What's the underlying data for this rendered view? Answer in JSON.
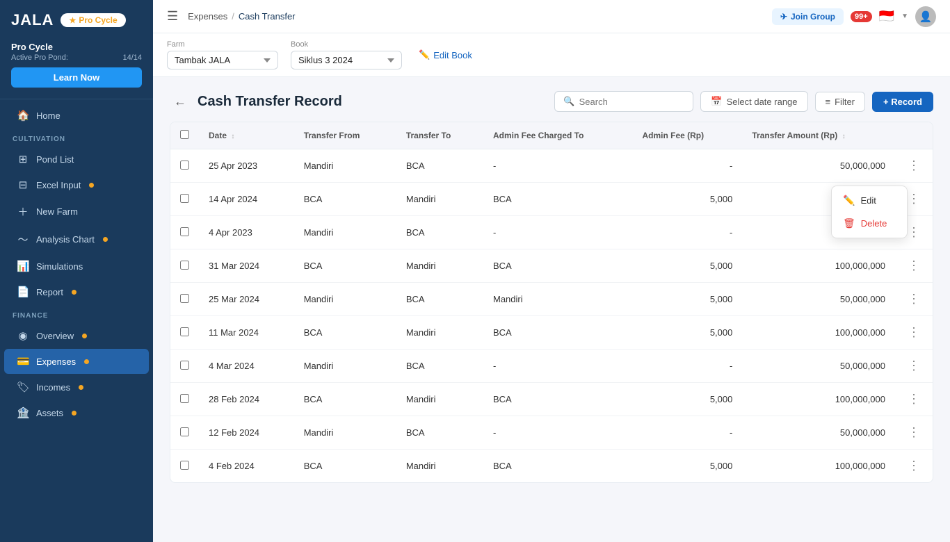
{
  "app": {
    "logo": "JALA",
    "pro_cycle_label": "Pro Cycle",
    "active_pond_label": "Active Pro Pond:",
    "active_pond_value": "14/14"
  },
  "sidebar": {
    "learn_now_label": "Learn Now",
    "nav_items": [
      {
        "id": "home",
        "label": "Home",
        "icon": "🏠",
        "active": false,
        "section": null
      },
      {
        "id": "pond-list",
        "label": "Pond List",
        "icon": "⊞",
        "active": false,
        "section": "CULTIVATION"
      },
      {
        "id": "excel-input",
        "label": "Excel Input",
        "icon": "⊟",
        "active": false,
        "section": null,
        "badge": true
      },
      {
        "id": "new-farm",
        "label": "New Farm",
        "icon": "+",
        "active": false,
        "section": null
      },
      {
        "id": "analysis-chart",
        "label": "Analysis Chart",
        "icon": "~",
        "active": false,
        "section": null,
        "badge": true
      },
      {
        "id": "simulations",
        "label": "Simulations",
        "icon": "📊",
        "active": false,
        "section": null
      },
      {
        "id": "report",
        "label": "Report",
        "icon": "📄",
        "active": false,
        "section": null,
        "badge": true
      },
      {
        "id": "overview",
        "label": "Overview",
        "icon": "◉",
        "active": false,
        "section": "FINANCE",
        "badge": true
      },
      {
        "id": "expenses",
        "label": "Expenses",
        "icon": "💳",
        "active": true,
        "section": null,
        "badge": true
      },
      {
        "id": "incomes",
        "label": "Incomes",
        "icon": "🏷",
        "active": false,
        "section": null,
        "badge": true
      },
      {
        "id": "assets",
        "label": "Assets",
        "icon": "🏦",
        "active": false,
        "section": null,
        "badge": true
      }
    ],
    "sections": [
      "CULTIVATION",
      "FINANCE"
    ]
  },
  "topbar": {
    "breadcrumb_parent": "Expenses",
    "breadcrumb_sep": "/",
    "breadcrumb_current": "Cash Transfer",
    "join_group_label": "Join Group",
    "notif_count": "99+",
    "hamburger_icon": "☰"
  },
  "selectors": {
    "farm_label": "Farm",
    "farm_value": "Tambak JALA",
    "book_label": "Book",
    "book_value": "Siklus 3 2024",
    "edit_book_label": "Edit Book"
  },
  "page": {
    "back_icon": "←",
    "title": "Cash Transfer Record",
    "search_placeholder": "Search",
    "date_range_label": "Select date range",
    "filter_label": "Filter",
    "record_label": "+ Record"
  },
  "table": {
    "columns": [
      {
        "id": "checkbox",
        "label": ""
      },
      {
        "id": "date",
        "label": "Date",
        "sortable": true
      },
      {
        "id": "transfer_from",
        "label": "Transfer From"
      },
      {
        "id": "transfer_to",
        "label": "Transfer To"
      },
      {
        "id": "admin_fee_charged_to",
        "label": "Admin Fee Charged To"
      },
      {
        "id": "admin_fee",
        "label": "Admin Fee (Rp)"
      },
      {
        "id": "transfer_amount",
        "label": "Transfer Amount (Rp)",
        "sortable": true
      },
      {
        "id": "actions",
        "label": ""
      }
    ],
    "rows": [
      {
        "date": "25 Apr 2023",
        "transfer_from": "Mandiri",
        "transfer_to": "BCA",
        "admin_fee_charged_to": "-",
        "admin_fee": "-",
        "transfer_amount": "50,000,000",
        "show_menu": false
      },
      {
        "date": "14 Apr 2024",
        "transfer_from": "BCA",
        "transfer_to": "Mandiri",
        "admin_fee_charged_to": "BCA",
        "admin_fee": "5,000",
        "transfer_amount": "",
        "show_menu": true
      },
      {
        "date": "4 Apr 2023",
        "transfer_from": "Mandiri",
        "transfer_to": "BCA",
        "admin_fee_charged_to": "-",
        "admin_fee": "-",
        "transfer_amount": "50,000,000",
        "show_menu": false
      },
      {
        "date": "31 Mar 2024",
        "transfer_from": "BCA",
        "transfer_to": "Mandiri",
        "admin_fee_charged_to": "BCA",
        "admin_fee": "5,000",
        "transfer_amount": "100,000,000",
        "show_menu": false
      },
      {
        "date": "25 Mar 2024",
        "transfer_from": "Mandiri",
        "transfer_to": "BCA",
        "admin_fee_charged_to": "Mandiri",
        "admin_fee": "5,000",
        "transfer_amount": "50,000,000",
        "show_menu": false
      },
      {
        "date": "11 Mar 2024",
        "transfer_from": "BCA",
        "transfer_to": "Mandiri",
        "admin_fee_charged_to": "BCA",
        "admin_fee": "5,000",
        "transfer_amount": "100,000,000",
        "show_menu": false
      },
      {
        "date": "4 Mar 2024",
        "transfer_from": "Mandiri",
        "transfer_to": "BCA",
        "admin_fee_charged_to": "-",
        "admin_fee": "-",
        "transfer_amount": "50,000,000",
        "show_menu": false
      },
      {
        "date": "28 Feb 2024",
        "transfer_from": "BCA",
        "transfer_to": "Mandiri",
        "admin_fee_charged_to": "BCA",
        "admin_fee": "5,000",
        "transfer_amount": "100,000,000",
        "show_menu": false
      },
      {
        "date": "12 Feb 2024",
        "transfer_from": "Mandiri",
        "transfer_to": "BCA",
        "admin_fee_charged_to": "-",
        "admin_fee": "-",
        "transfer_amount": "50,000,000",
        "show_menu": false
      },
      {
        "date": "4 Feb 2024",
        "transfer_from": "BCA",
        "transfer_to": "Mandiri",
        "admin_fee_charged_to": "BCA",
        "admin_fee": "5,000",
        "transfer_amount": "100,000,000",
        "show_menu": false
      }
    ],
    "context_menu": {
      "edit_label": "Edit",
      "delete_label": "Delete"
    }
  }
}
